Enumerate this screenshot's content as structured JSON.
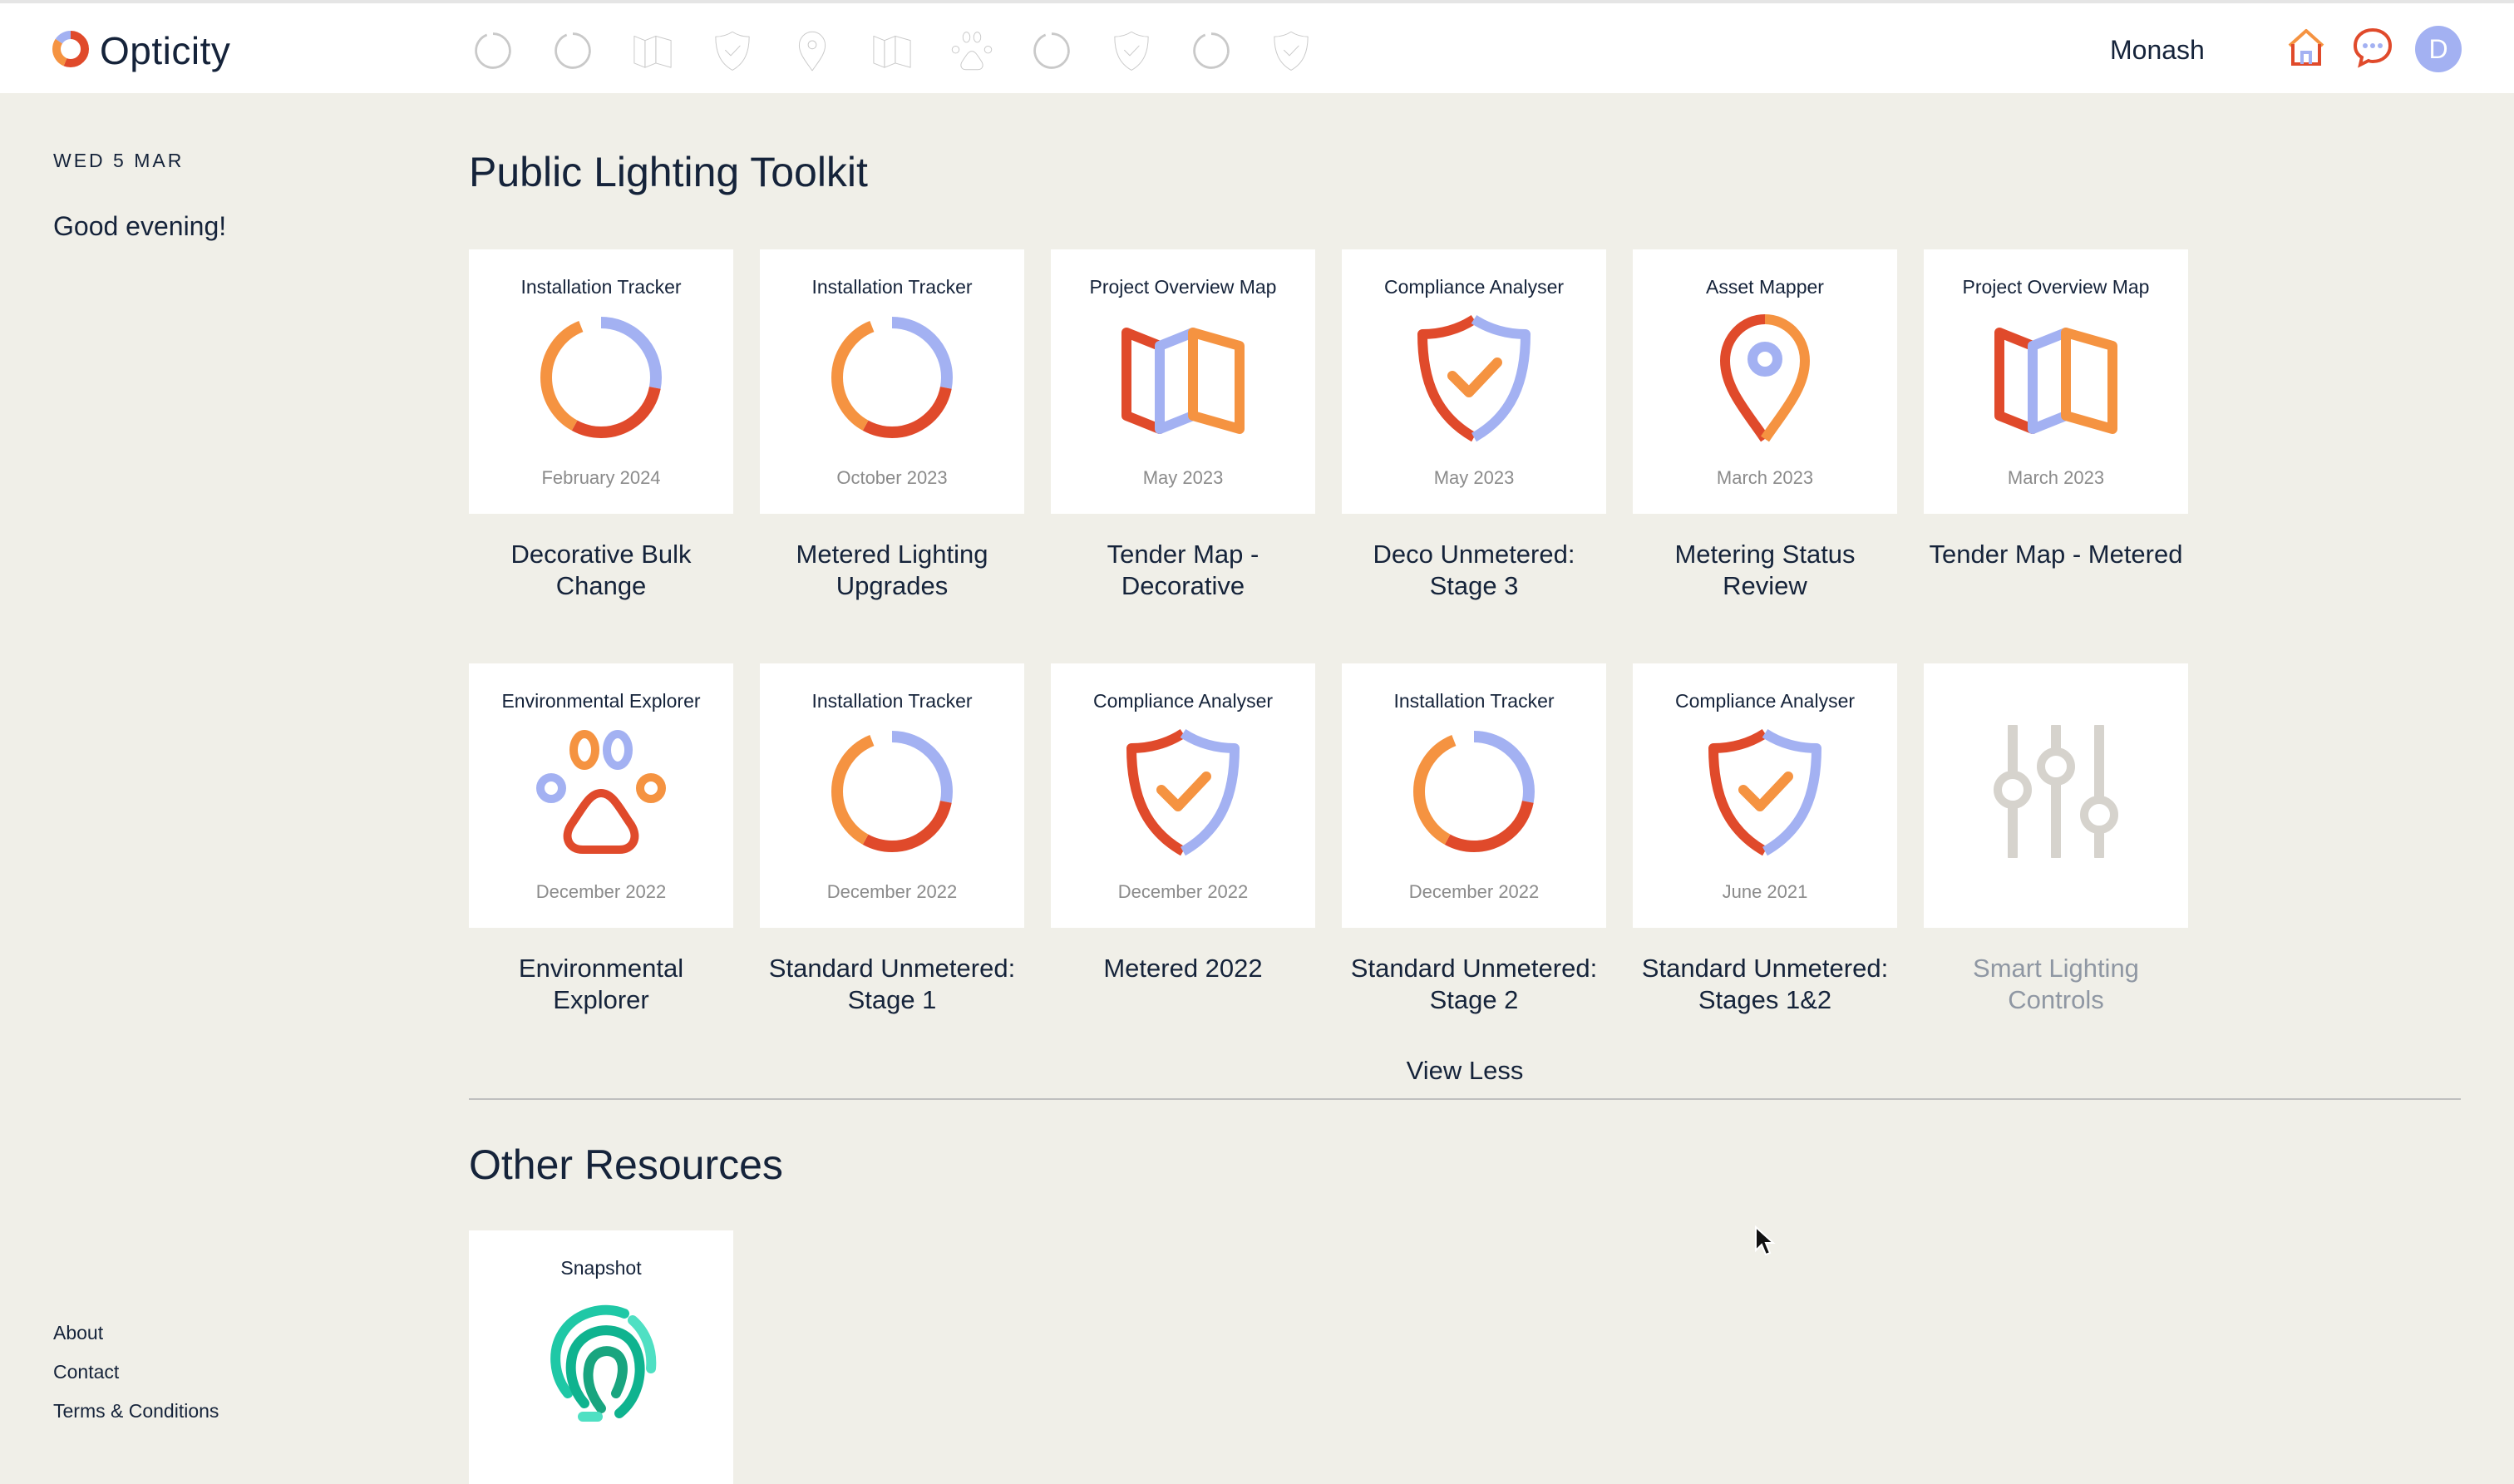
{
  "app": {
    "name": "Opticity",
    "user_name": "Monash",
    "avatar_initial": "D"
  },
  "nav_icons": [
    "tracker-icon",
    "tracker-icon",
    "map-icon",
    "shield-icon",
    "pin-icon",
    "map-icon",
    "paw-icon",
    "tracker-icon",
    "shield-icon",
    "tracker-icon",
    "shield-icon"
  ],
  "sidebar": {
    "date": "WED 5 MAR",
    "greeting": "Good evening!",
    "links": [
      "About",
      "Contact",
      "Terms & Conditions"
    ]
  },
  "toolkit": {
    "title": "Public Lighting Toolkit",
    "view_less": "View Less",
    "tiles": [
      {
        "category": "Installation Tracker",
        "date": "February 2024",
        "title": "Decorative Bulk Change",
        "icon": "tracker"
      },
      {
        "category": "Installation Tracker",
        "date": "October 2023",
        "title": "Metered Lighting Upgrades",
        "icon": "tracker"
      },
      {
        "category": "Project Overview Map",
        "date": "May 2023",
        "title": "Tender Map - Decorative",
        "icon": "map"
      },
      {
        "category": "Compliance Analyser",
        "date": "May 2023",
        "title": "Deco Unmetered: Stage 3",
        "icon": "shield"
      },
      {
        "category": "Asset Mapper",
        "date": "March 2023",
        "title": "Metering Status Review",
        "icon": "pin"
      },
      {
        "category": "Project Overview Map",
        "date": "March 2023",
        "title": "Tender Map - Metered",
        "icon": "map"
      },
      {
        "category": "Environmental Explorer",
        "date": "December 2022",
        "title": "Environmental Explorer",
        "icon": "paw"
      },
      {
        "category": "Installation Tracker",
        "date": "December 2022",
        "title": "Standard Unmetered: Stage 1",
        "icon": "tracker"
      },
      {
        "category": "Compliance Analyser",
        "date": "December 2022",
        "title": "Metered 2022",
        "icon": "shield"
      },
      {
        "category": "Installation Tracker",
        "date": "December 2022",
        "title": "Standard Unmetered: Stage 2",
        "icon": "tracker"
      },
      {
        "category": "Compliance Analyser",
        "date": "June 2021",
        "title": "Standard Unmetered: Stages 1&2",
        "icon": "shield"
      },
      {
        "category": "",
        "date": "",
        "title": "Smart Lighting Controls",
        "icon": "sliders"
      }
    ]
  },
  "resources": {
    "title": "Other Resources",
    "tiles": [
      {
        "category": "Snapshot",
        "icon": "fingerprint"
      }
    ]
  },
  "colors": {
    "red": "#e04a2b",
    "orange": "#f59341",
    "lavender": "#a3b1f2",
    "teal": "#1fc8a6",
    "grey_icon": "#d6d3cd"
  }
}
